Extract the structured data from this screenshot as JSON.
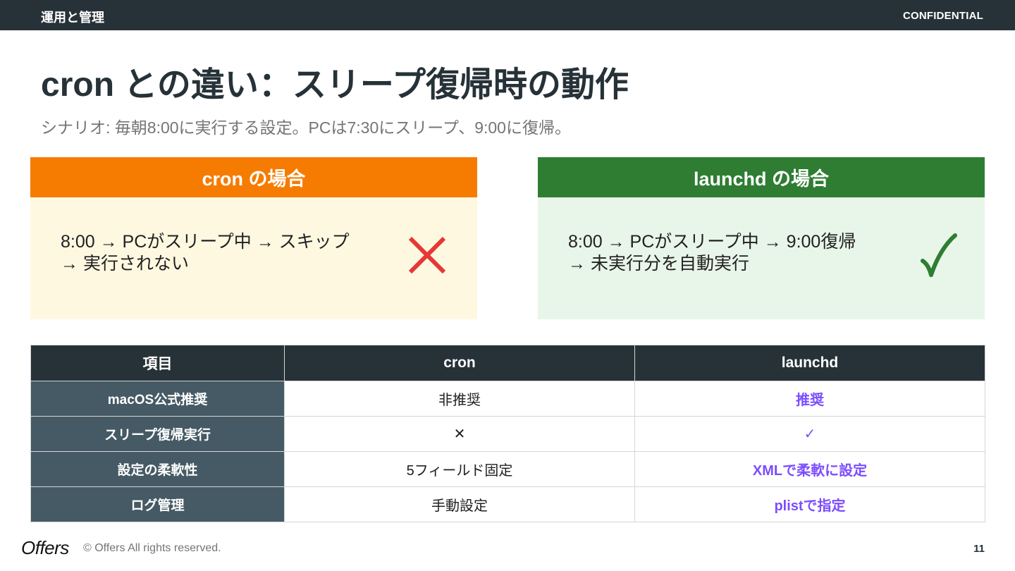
{
  "header": {
    "section": "運用と管理",
    "confidential": "CONFIDENTIAL"
  },
  "slide": {
    "title": "cron との違い：スリープ復帰時の動作",
    "subtitle": "シナリオ: 毎朝8:00に実行する設定。PCは7:30にスリープ、9:00に復帰。"
  },
  "cards": {
    "cron": {
      "title": "cron の場合",
      "line1": "8:00 → PCがスリープ中 → スキップ",
      "line2": "→ 実行されない",
      "result_icon": "cross-icon",
      "header_color": "#f57c00",
      "body_color": "#fff8e1",
      "icon_color": "#e53935"
    },
    "launchd": {
      "title": "launchd の場合",
      "line1": "8:00 → PCがスリープ中 → 9:00復帰",
      "line2": "→ 未実行分を自動実行",
      "result_icon": "check-icon",
      "header_color": "#2e7d32",
      "body_color": "#e8f5e9",
      "icon_color": "#2e7d32"
    }
  },
  "table": {
    "headers": [
      "項目",
      "cron",
      "launchd"
    ],
    "rows": [
      {
        "item": "macOS公式推奨",
        "cron": "非推奨",
        "launchd": "推奨"
      },
      {
        "item": "スリープ復帰実行",
        "cron": "✕",
        "launchd": "✓"
      },
      {
        "item": "設定の柔軟性",
        "cron": "5フィールド固定",
        "launchd": "XMLで柔軟に設定"
      },
      {
        "item": "ログ管理",
        "cron": "手動設定",
        "launchd": "plistで指定"
      }
    ],
    "accent_color": "#7c4dff"
  },
  "footer": {
    "logo": "Offers",
    "copyright": "© Offers All rights reserved.",
    "page_number": "11"
  }
}
